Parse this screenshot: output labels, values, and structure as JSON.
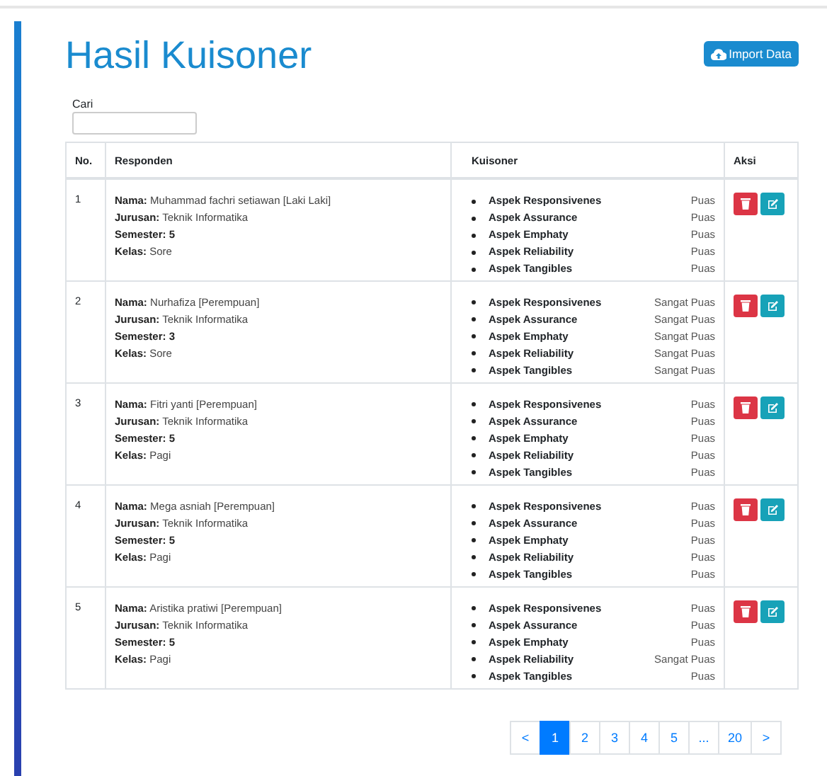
{
  "page": {
    "title": "Hasil Kuisoner",
    "import_button": "Import Data"
  },
  "search": {
    "label": "Cari"
  },
  "table": {
    "columns": [
      "No.",
      "Responden",
      "Kuisoner",
      "Aksi"
    ],
    "rows": [
      {
        "no": "1",
        "fields": [
          {
            "label": "Nama:",
            "value": "Muhammad fachri setiawan [Laki Laki]",
            "bold": false
          },
          {
            "label": "Jurusan:",
            "value": "Teknik Informatika",
            "bold": false
          },
          {
            "label": "Semester:",
            "value": "5",
            "bold": true
          },
          {
            "label": "Kelas:",
            "value": "Sore",
            "bold": false
          }
        ],
        "aspects": [
          {
            "name": "Aspek Responsivenes",
            "rating": "Puas"
          },
          {
            "name": "Aspek Assurance",
            "rating": "Puas"
          },
          {
            "name": "Aspek Emphaty",
            "rating": "Puas"
          },
          {
            "name": "Aspek Reliability",
            "rating": "Puas"
          },
          {
            "name": "Aspek Tangibles",
            "rating": "Puas"
          }
        ]
      },
      {
        "no": "2",
        "fields": [
          {
            "label": "Nama:",
            "value": "Nurhafiza [Perempuan]",
            "bold": false
          },
          {
            "label": "Jurusan:",
            "value": "Teknik Informatika",
            "bold": false
          },
          {
            "label": "Semester:",
            "value": "3",
            "bold": true
          },
          {
            "label": "Kelas:",
            "value": "Sore",
            "bold": false
          }
        ],
        "aspects": [
          {
            "name": "Aspek Responsivenes",
            "rating": "Sangat Puas"
          },
          {
            "name": "Aspek Assurance",
            "rating": "Sangat Puas"
          },
          {
            "name": "Aspek Emphaty",
            "rating": "Sangat Puas"
          },
          {
            "name": "Aspek Reliability",
            "rating": "Sangat Puas"
          },
          {
            "name": "Aspek Tangibles",
            "rating": "Sangat Puas"
          }
        ]
      },
      {
        "no": "3",
        "fields": [
          {
            "label": "Nama:",
            "value": "Fitri yanti [Perempuan]",
            "bold": false
          },
          {
            "label": "Jurusan:",
            "value": "Teknik Informatika",
            "bold": false
          },
          {
            "label": "Semester:",
            "value": "5",
            "bold": true
          },
          {
            "label": "Kelas:",
            "value": "Pagi",
            "bold": false
          }
        ],
        "aspects": [
          {
            "name": "Aspek Responsivenes",
            "rating": "Puas"
          },
          {
            "name": "Aspek Assurance",
            "rating": "Puas"
          },
          {
            "name": "Aspek Emphaty",
            "rating": "Puas"
          },
          {
            "name": "Aspek Reliability",
            "rating": "Puas"
          },
          {
            "name": "Aspek Tangibles",
            "rating": "Puas"
          }
        ]
      },
      {
        "no": "4",
        "fields": [
          {
            "label": "Nama:",
            "value": "Mega asniah [Perempuan]",
            "bold": false
          },
          {
            "label": "Jurusan:",
            "value": "Teknik Informatika",
            "bold": false
          },
          {
            "label": "Semester:",
            "value": "5",
            "bold": true
          },
          {
            "label": "Kelas:",
            "value": "Pagi",
            "bold": false
          }
        ],
        "aspects": [
          {
            "name": "Aspek Responsivenes",
            "rating": "Puas"
          },
          {
            "name": "Aspek Assurance",
            "rating": "Puas"
          },
          {
            "name": "Aspek Emphaty",
            "rating": "Puas"
          },
          {
            "name": "Aspek Reliability",
            "rating": "Puas"
          },
          {
            "name": "Aspek Tangibles",
            "rating": "Puas"
          }
        ]
      },
      {
        "no": "5",
        "fields": [
          {
            "label": "Nama:",
            "value": "Aristika pratiwi [Perempuan]",
            "bold": false
          },
          {
            "label": "Jurusan:",
            "value": "Teknik Informatika",
            "bold": false
          },
          {
            "label": "Semester:",
            "value": "5",
            "bold": true
          },
          {
            "label": "Kelas:",
            "value": "Pagi",
            "bold": false
          }
        ],
        "aspects": [
          {
            "name": "Aspek Responsivenes",
            "rating": "Puas"
          },
          {
            "name": "Aspek Assurance",
            "rating": "Puas"
          },
          {
            "name": "Aspek Emphaty",
            "rating": "Puas"
          },
          {
            "name": "Aspek Reliability",
            "rating": "Sangat Puas"
          },
          {
            "name": "Aspek Tangibles",
            "rating": "Puas"
          }
        ]
      }
    ]
  },
  "pagination": [
    {
      "label": "<",
      "selected": false
    },
    {
      "label": "1",
      "selected": true
    },
    {
      "label": "2",
      "selected": false
    },
    {
      "label": "3",
      "selected": false
    },
    {
      "label": "4",
      "selected": false
    },
    {
      "label": "5",
      "selected": false
    },
    {
      "label": "...",
      "selected": false
    },
    {
      "label": "20",
      "selected": false
    },
    {
      "label": ">",
      "selected": false
    }
  ]
}
